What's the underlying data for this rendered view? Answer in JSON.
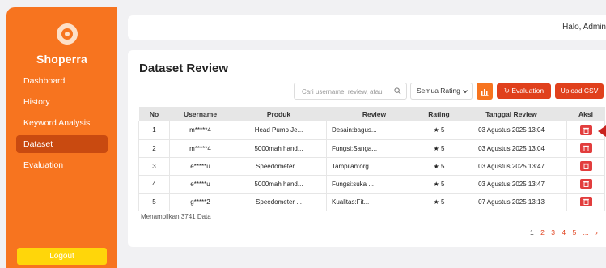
{
  "sidebar": {
    "brand": "Shoperra",
    "items": [
      {
        "label": "Dashboard",
        "active": false
      },
      {
        "label": "History",
        "active": false
      },
      {
        "label": "Keyword Analysis",
        "active": false
      },
      {
        "label": "Dataset",
        "active": true
      },
      {
        "label": "Evaluation",
        "active": false
      }
    ],
    "logout_label": "Logout"
  },
  "topbar": {
    "greeting": "Halo, Admin"
  },
  "main": {
    "title": "Dataset Review",
    "search_placeholder": "Cari username, review, atau",
    "rating_filter": "Semua Rating",
    "evaluation_label": "Evaluation",
    "upload_label": "Upload CSV",
    "table": {
      "headers": [
        "No",
        "Username",
        "Produk",
        "Review",
        "Rating",
        "Tanggal Review",
        "Aksi"
      ],
      "rows": [
        {
          "no": "1",
          "username": "m*****4",
          "produk": "Head Pump Je...",
          "review": "Desain:bagus...",
          "rating": "★ 5",
          "tanggal": "03 Agustus 2025 13:04"
        },
        {
          "no": "2",
          "username": "m*****4",
          "produk": "5000mah hand...",
          "review": "Fungsi:Sanga...",
          "rating": "★ 5",
          "tanggal": "03 Agustus 2025 13:04"
        },
        {
          "no": "3",
          "username": "e*****u",
          "produk": "Speedometer ...",
          "review": "Tampilan:org...",
          "rating": "★ 5",
          "tanggal": "03 Agustus 2025 13:47"
        },
        {
          "no": "4",
          "username": "e*****u",
          "produk": "5000mah hand...",
          "review": "Fungsi:suka ...",
          "rating": "★ 5",
          "tanggal": "03 Agustus 2025 13:47"
        },
        {
          "no": "5",
          "username": "g*****2",
          "produk": "Speedometer ...",
          "review": "Kualitas:Fit...",
          "rating": "★ 5",
          "tanggal": "07 Agustus 2025 13:13"
        }
      ]
    },
    "count_text": "Menampilkan 3741 Data",
    "pagination": {
      "pages": [
        "1",
        "2",
        "3",
        "4",
        "5"
      ],
      "current": "1",
      "ellipsis": "...",
      "next": "›"
    }
  },
  "colors": {
    "sidebar": "#f7741f",
    "active_nav": "#c94a10",
    "primary_button": "#e0401c",
    "logout_button": "#ffd60a",
    "delete_button": "#e23d3d"
  },
  "icons": [
    "logo-icon",
    "search-icon",
    "chevron-down-icon",
    "bar-chart-icon",
    "refresh-icon",
    "trash-icon"
  ]
}
